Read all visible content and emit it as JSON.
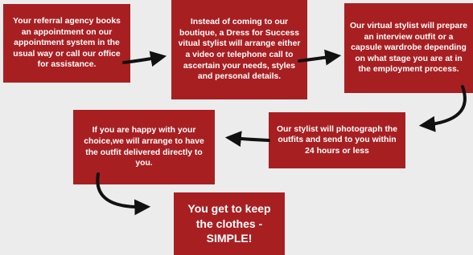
{
  "steps": [
    {
      "text": "Your referral agency books an appointment on our appointment system in the usual way or call our office for assistance."
    },
    {
      "text": "Instead of coming to our boutique, a Dress for Success vitual stylist will arrange either a video or telephone call to ascertain your needs, styles and personal details."
    },
    {
      "text": "Our virtual stylist will prepare an interview outfit or a capsule wardrobe depending on what stage you are at in the employment process."
    },
    {
      "text": "Our stylist will photograph the outfits and send to you within 24 hours or less"
    },
    {
      "text": "If you are happy with your choice,we will arrange to have the outfit delivered directly to you."
    },
    {
      "text": "You get to keep the clothes - SIMPLE!"
    }
  ],
  "colors": {
    "box": "#a81f22",
    "background": "#ececec",
    "arrow": "#111111",
    "text": "#ffffff"
  }
}
